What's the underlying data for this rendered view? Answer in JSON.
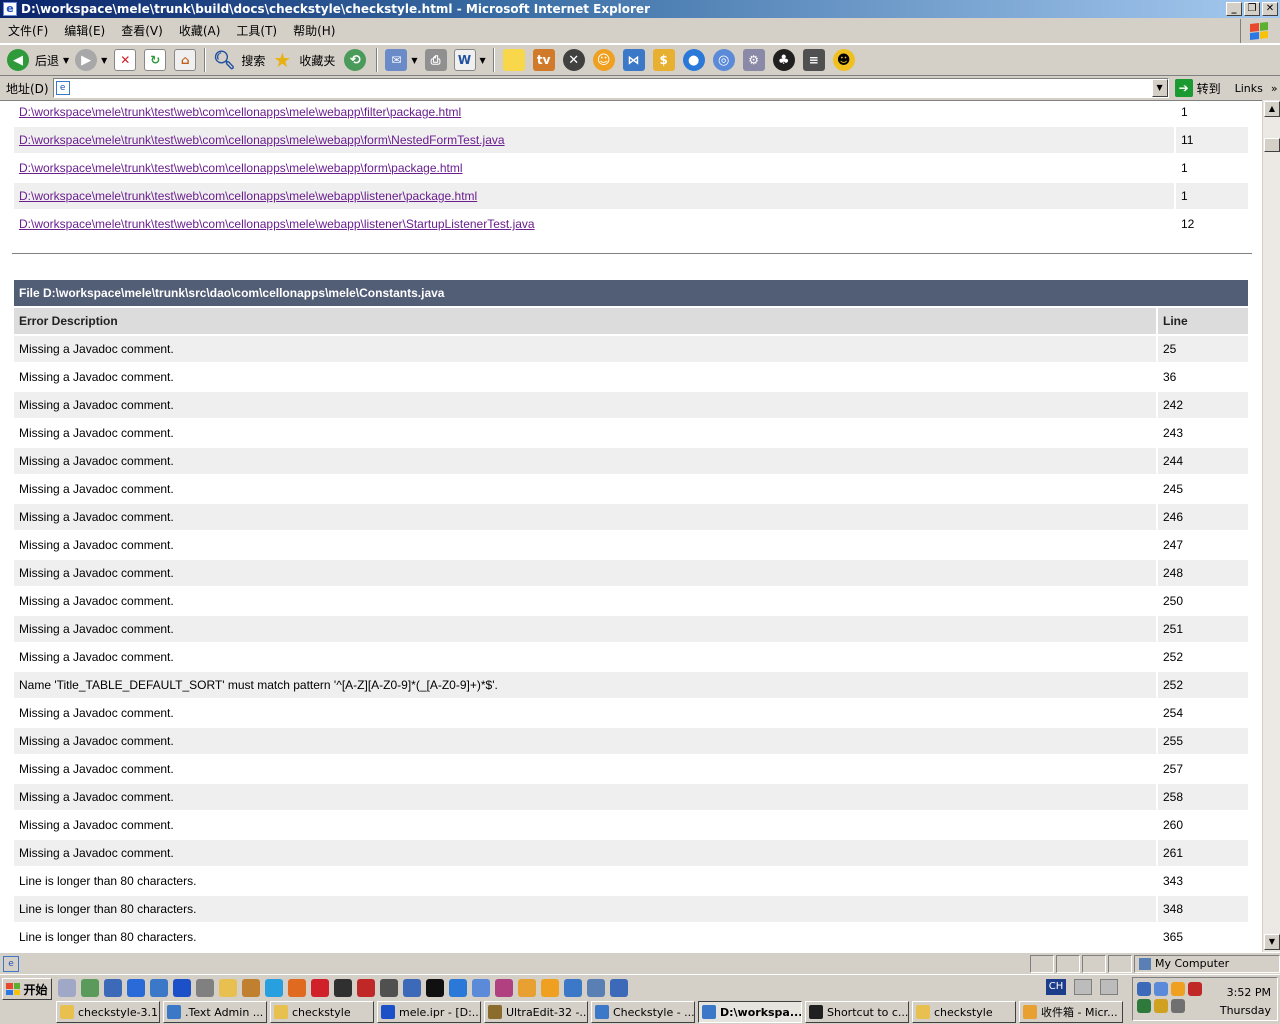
{
  "window": {
    "title": "D:\\workspace\\mele\\trunk\\build\\docs\\checkstyle\\checkstyle.html - Microsoft Internet Explorer",
    "minimize": "_",
    "maximize": "❐",
    "close": "✕"
  },
  "menu": [
    "文件(F)",
    "编辑(E)",
    "查看(V)",
    "收藏(A)",
    "工具(T)",
    "帮助(H)"
  ],
  "toolbar": {
    "back_label": "后退",
    "search_label": "搜索",
    "favorites_label": "收藏夹"
  },
  "address": {
    "label": "地址(D)",
    "value": "",
    "go_label": "转到",
    "links_label": "Links",
    "links_more": "»"
  },
  "files": [
    {
      "path": "D:\\workspace\\mele\\trunk\\test\\web\\com\\cellonapps\\mele\\webapp\\filter\\package.html",
      "count": "1"
    },
    {
      "path": "D:\\workspace\\mele\\trunk\\test\\web\\com\\cellonapps\\mele\\webapp\\form\\NestedFormTest.java",
      "count": "11"
    },
    {
      "path": "D:\\workspace\\mele\\trunk\\test\\web\\com\\cellonapps\\mele\\webapp\\form\\package.html",
      "count": "1"
    },
    {
      "path": "D:\\workspace\\mele\\trunk\\test\\web\\com\\cellonapps\\mele\\webapp\\listener\\package.html",
      "count": "1"
    },
    {
      "path": "D:\\workspace\\mele\\trunk\\test\\web\\com\\cellonapps\\mele\\webapp\\listener\\StartupListenerTest.java",
      "count": "12"
    }
  ],
  "file_section": {
    "title": "File D:\\workspace\\mele\\trunk\\src\\dao\\com\\cellonapps\\mele\\Constants.java",
    "col_description": "Error Description",
    "col_line": "Line"
  },
  "errors": [
    {
      "desc": "Missing a Javadoc comment.",
      "line": "25"
    },
    {
      "desc": "Missing a Javadoc comment.",
      "line": "36"
    },
    {
      "desc": "Missing a Javadoc comment.",
      "line": "242"
    },
    {
      "desc": "Missing a Javadoc comment.",
      "line": "243"
    },
    {
      "desc": "Missing a Javadoc comment.",
      "line": "244"
    },
    {
      "desc": "Missing a Javadoc comment.",
      "line": "245"
    },
    {
      "desc": "Missing a Javadoc comment.",
      "line": "246"
    },
    {
      "desc": "Missing a Javadoc comment.",
      "line": "247"
    },
    {
      "desc": "Missing a Javadoc comment.",
      "line": "248"
    },
    {
      "desc": "Missing a Javadoc comment.",
      "line": "250"
    },
    {
      "desc": "Missing a Javadoc comment.",
      "line": "251"
    },
    {
      "desc": "Missing a Javadoc comment.",
      "line": "252"
    },
    {
      "desc": "Name 'Title_TABLE_DEFAULT_SORT' must match pattern '^[A-Z][A-Z0-9]*(_[A-Z0-9]+)*$'.",
      "line": "252"
    },
    {
      "desc": "Missing a Javadoc comment.",
      "line": "254"
    },
    {
      "desc": "Missing a Javadoc comment.",
      "line": "255"
    },
    {
      "desc": "Missing a Javadoc comment.",
      "line": "257"
    },
    {
      "desc": "Missing a Javadoc comment.",
      "line": "258"
    },
    {
      "desc": "Missing a Javadoc comment.",
      "line": "260"
    },
    {
      "desc": "Missing a Javadoc comment.",
      "line": "261"
    },
    {
      "desc": "Line is longer than 80 characters.",
      "line": "343"
    },
    {
      "desc": "Line is longer than 80 characters.",
      "line": "348"
    },
    {
      "desc": "Line is longer than 80 characters.",
      "line": "365"
    }
  ],
  "statusbar": {
    "zone": "My Computer"
  },
  "taskbar": {
    "start_label": "开始",
    "tasks": [
      {
        "label": "checkstyle-3.1",
        "icon_color": "#e8c050"
      },
      {
        "label": ".Text Admin ...",
        "icon_color": "#3c78c8"
      },
      {
        "label": "checkstyle",
        "icon_color": "#e8c050"
      },
      {
        "label": "mele.ipr - [D:...",
        "icon_color": "#1c50c8"
      },
      {
        "label": "UltraEdit-32 -...",
        "icon_color": "#8c6c2c"
      },
      {
        "label": "Checkstyle - ...",
        "icon_color": "#3c78c8"
      },
      {
        "label": "D:\\workspa...",
        "icon_color": "#3c78c8"
      },
      {
        "label": "Shortcut to c...",
        "icon_color": "#202020"
      },
      {
        "label": "checkstyle",
        "icon_color": "#e8c050"
      },
      {
        "label": "收件箱 - Micr...",
        "icon_color": "#e8a030"
      }
    ],
    "active_task": 6,
    "lang": "CH",
    "time": "3:52 PM",
    "day": "Thursday"
  }
}
